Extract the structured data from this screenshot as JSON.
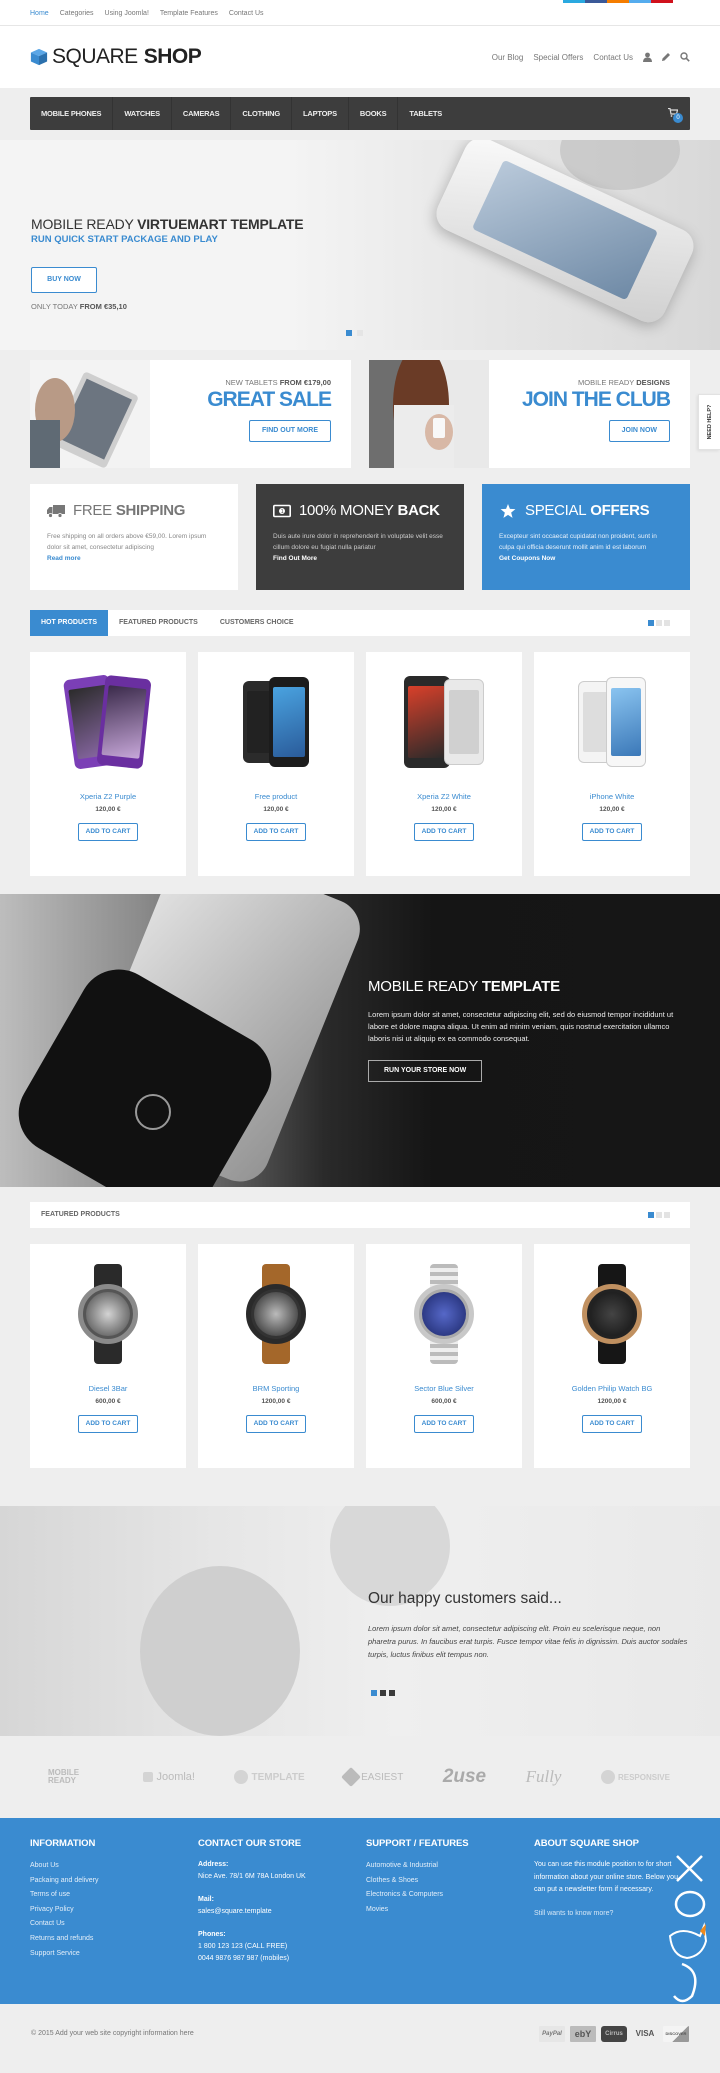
{
  "topbar": {
    "links": [
      {
        "label": "Home",
        "active": true
      },
      {
        "label": "Categories"
      },
      {
        "label": "Using Joomla!"
      },
      {
        "label": "Template Features"
      },
      {
        "label": "Contact Us"
      }
    ],
    "social_colors": [
      "#2aa9e0",
      "#3b5998",
      "#f57d00",
      "#55acee",
      "#d0111c"
    ]
  },
  "header": {
    "logo_light": "SQUARE",
    "logo_bold": "SHOP",
    "links": [
      "Our Blog",
      "Special Offers",
      "Contact Us"
    ],
    "icons": [
      "user-icon",
      "pencil-icon",
      "search-icon"
    ]
  },
  "mainnav": {
    "items": [
      "MOBILE PHONES",
      "WATCHES",
      "CAMERAS",
      "CLOTHING",
      "LAPTOPS",
      "BOOKS",
      "TABLETS"
    ],
    "cart_count": "0"
  },
  "hero": {
    "title_light": "MOBILE READY ",
    "title_bold": "VIRTUEMART TEMPLATE",
    "subtitle": "RUN QUICK START PACKAGE AND PLAY",
    "button": "BUY NOW",
    "price_light": "ONLY TODAY ",
    "price_bold": "FROM €35,10",
    "slides": 2,
    "active_slide": 1
  },
  "promos": [
    {
      "small_light": "NEW TABLETS ",
      "small_bold": "FROM €179,00",
      "big": "GREAT SALE",
      "button": "FIND OUT MORE"
    },
    {
      "small_light": "MOBILE READY ",
      "small_bold": "DESIGNS",
      "big": "JOIN THE CLUB",
      "button": "JOIN NOW"
    }
  ],
  "need_help": "NEED HELP?",
  "infoboxes": [
    {
      "title_light": "FREE",
      "title_bold": "SHIPPING",
      "text": "Free shipping on all orders above €59,00. Lorem ipsum dolor sit amet, consectetur adipiscing",
      "link": "Read more",
      "icon": "truck-icon"
    },
    {
      "title_light": "100% MONEY",
      "title_bold": "BACK",
      "text": "Duis aute irure dolor in reprehenderit in voluptate velit esse cillum dolore eu fugiat nulla pariatur",
      "link": "Find Out More",
      "icon": "money-icon"
    },
    {
      "title_light": "SPECIAL",
      "title_bold": "OFFERS",
      "text": "Excepteur sint occaecat cupidatat non proident, sunt in culpa qui officia deserunt mollit anim id est laborum",
      "link": "Get Coupons Now",
      "icon": "star-icon"
    }
  ],
  "tabs": {
    "items": [
      "HOT PRODUCTS",
      "FEATURED PRODUCTS",
      "CUSTOMERS CHOICE"
    ],
    "active": 0
  },
  "hot_products": [
    {
      "name": "Xperia Z2 Purple",
      "price": "120,00 €",
      "button": "ADD TO CART"
    },
    {
      "name": "Free product",
      "price": "120,00 €",
      "button": "ADD TO CART"
    },
    {
      "name": "Xperia Z2 White",
      "price": "120,00 €",
      "button": "ADD TO CART"
    },
    {
      "name": "iPhone White",
      "price": "120,00 €",
      "button": "ADD TO CART"
    }
  ],
  "dark_banner": {
    "title_light": "MOBILE READY ",
    "title_bold": "TEMPLATE",
    "text": "Lorem ipsum dolor sit amet, consectetur adipiscing elit, sed do eiusmod tempor incididunt ut labore et dolore magna aliqua. Ut enim ad minim veniam, quis nostrud exercitation ullamco laboris nisi ut aliquip ex ea commodo consequat.",
    "button": "RUN YOUR STORE NOW"
  },
  "featured": {
    "title": "FEATURED PRODUCTS",
    "products": [
      {
        "name": "Diesel 3Bar",
        "price": "600,00 €",
        "button": "ADD TO CART"
      },
      {
        "name": "BRM Sporting",
        "price": "1200,00 €",
        "button": "ADD TO CART"
      },
      {
        "name": "Sector Blue Silver",
        "price": "600,00 €",
        "button": "ADD TO CART"
      },
      {
        "name": "Golden Philip Watch BG",
        "price": "1200,00 €",
        "button": "ADD TO CART"
      }
    ]
  },
  "testimonial": {
    "title": "Our happy customers said...",
    "text": "Lorem ipsum dolor sit amet, consectetur adipiscing elit. Proin eu scelerisque neque, non pharetra purus. In faucibus erat turpis. Fusce tempor vitae felis in dignissim. Duis auctor sodales turpis, luctus finibus elit tempus non."
  },
  "partner_logos": [
    "MOBILE READY",
    "Joomla!",
    "TEMPLATE",
    "EASIEST",
    "2use",
    "Fully",
    "RESPONSIVE"
  ],
  "footer": {
    "information": {
      "title": "INFORMATION",
      "links": [
        "About Us",
        "Packaing and delivery",
        "Terms of use",
        "Privacy Policy",
        "Contact Us",
        "Returns and refunds",
        "Support Service"
      ]
    },
    "contact": {
      "title": "CONTACT OUR STORE",
      "address_label": "Address:",
      "address": "Nice Ave. 78/1 6M 78A London UK",
      "mail_label": "Mail:",
      "mail": "sales@square.template",
      "phones_label": "Phones:",
      "phone1": "1 800 123 123 (CALL FREE)",
      "phone2": "0044 9876 987 987 (mobiles)"
    },
    "support": {
      "title": "SUPPORT / FEATURES",
      "links": [
        "Automotive & Industrial",
        "Clothes & Shoes",
        "Electronics & Computers",
        "Movies"
      ]
    },
    "about": {
      "title": "ABOUT SQUARE SHOP",
      "text": "You can use this module position to for short information about your online store. Below you can put a newsletter form if necessary.",
      "more": "Still wants to know more?"
    }
  },
  "bottom": {
    "copyright": "© 2015 Add your web site copyright information here",
    "payments": [
      "PayPal",
      "ebY",
      "Cirrus",
      "VISA",
      "DISCOVER"
    ]
  }
}
